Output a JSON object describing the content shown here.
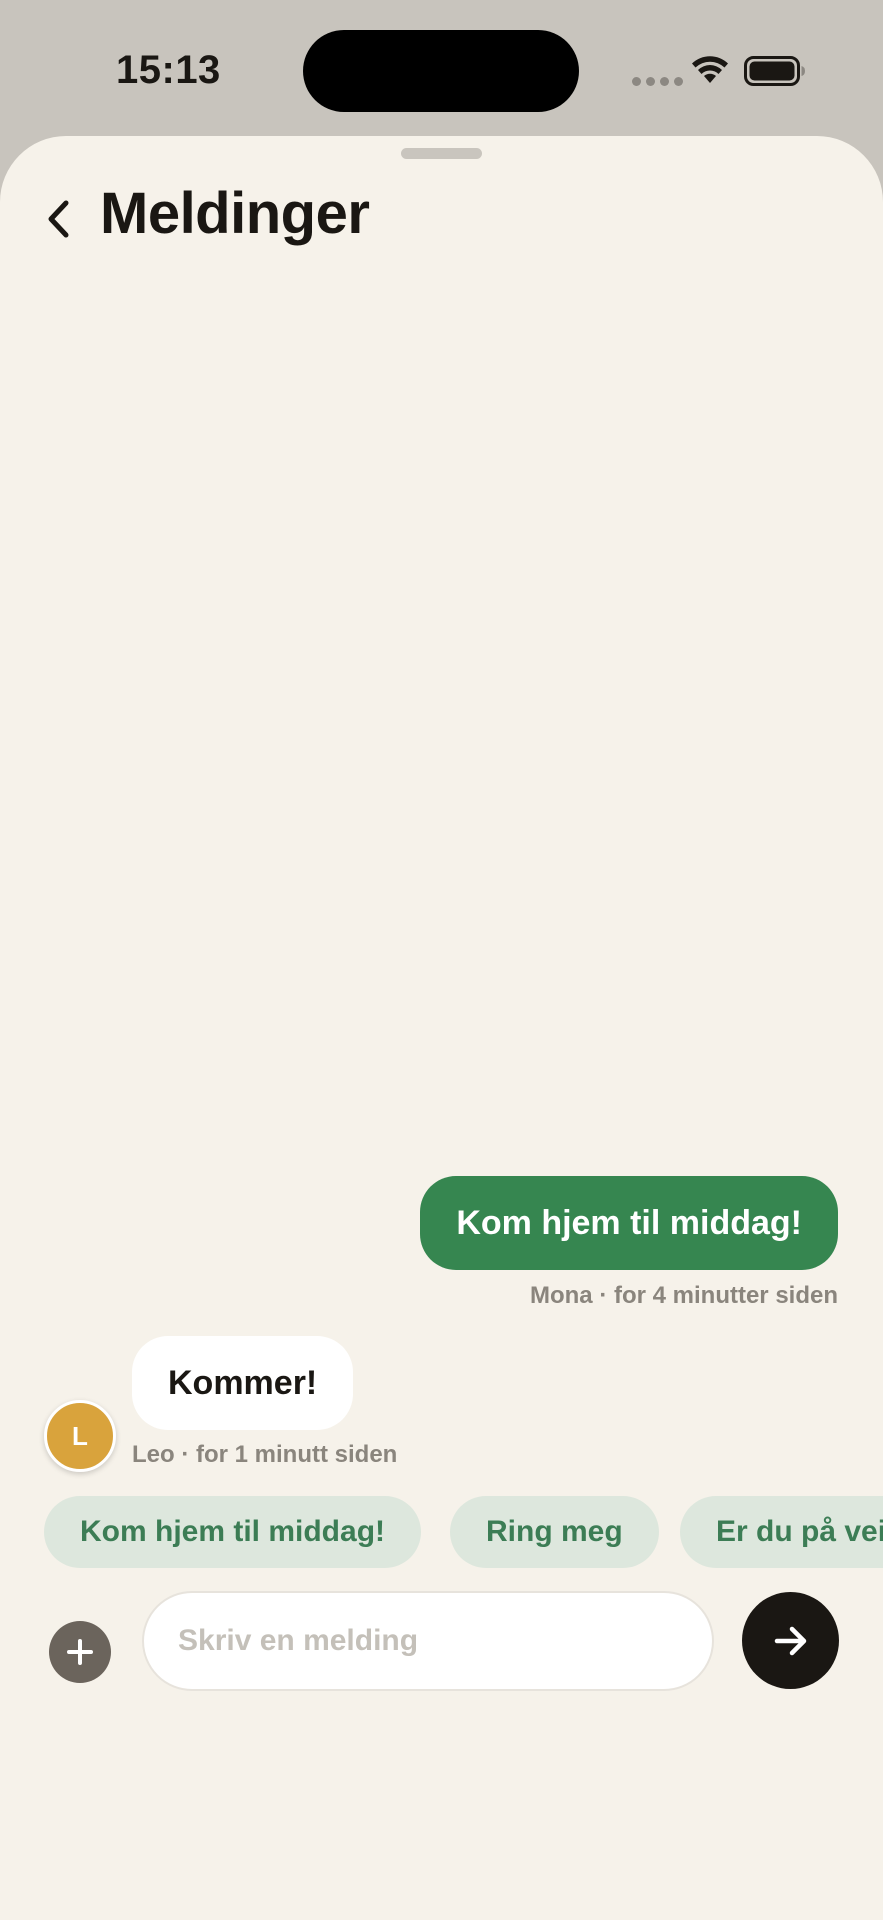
{
  "status_bar": {
    "time": "15:13"
  },
  "header": {
    "title": "Meldinger",
    "back_icon": "chevron-left-icon"
  },
  "messages": [
    {
      "direction": "outgoing",
      "text": "Kom hjem til middag!",
      "meta": "Mona · for 4 minutter siden"
    },
    {
      "direction": "incoming",
      "text": "Kommer!",
      "meta": "Leo · for 1 minutt siden",
      "avatar_initial": "L"
    }
  ],
  "quick_replies": [
    "Kom hjem til middag!",
    "Ring meg",
    "Er du på vei?"
  ],
  "composer": {
    "placeholder": "Skriv en melding",
    "add_icon": "plus-icon",
    "send_icon": "arrow-right-icon"
  },
  "colors": {
    "background": "#f6f2ea",
    "outgoing_bubble": "#368650",
    "incoming_bubble": "#ffffff",
    "quick_reply_bg": "#dde7dd",
    "quick_reply_text": "#3c7d55",
    "avatar": "#d9a33c",
    "send_button": "#1a1713"
  }
}
